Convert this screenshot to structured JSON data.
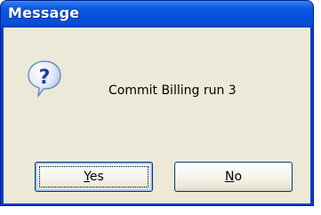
{
  "window": {
    "title": "Message"
  },
  "dialog": {
    "icon": "question-icon",
    "message": "Commit Billing run 3"
  },
  "buttons": {
    "yes": {
      "accel": "Y",
      "rest": "es"
    },
    "no": {
      "accel": "N",
      "rest": "o"
    }
  },
  "colors": {
    "titlebar": "#0752dc",
    "dialog_bg": "#ece9d8",
    "button_border": "#003c74"
  }
}
